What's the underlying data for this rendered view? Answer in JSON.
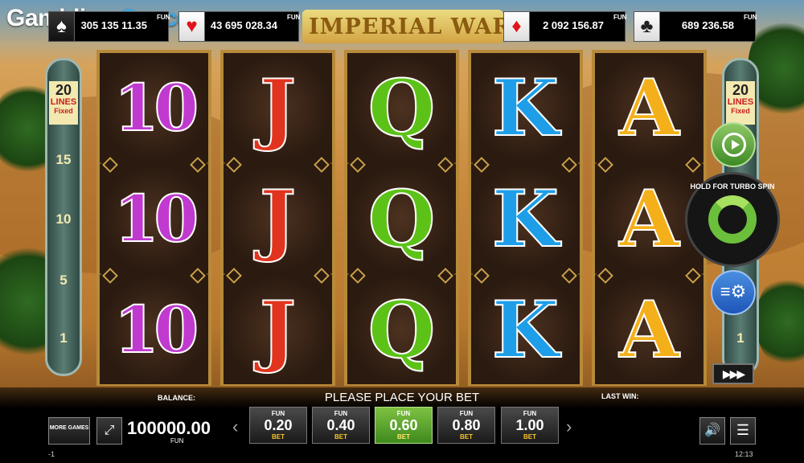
{
  "brand": {
    "part1": "Gambling",
    "part2": "Space"
  },
  "game_title": "IMPERIAL WARS",
  "jackpots": [
    {
      "suit": "♠",
      "value": "305 135 11.35",
      "currency": "FUN"
    },
    {
      "suit": "♥",
      "value": "43 695 028.34",
      "currency": "FUN"
    },
    {
      "suit": "♦",
      "value": "2 092 156.87",
      "currency": "FUN"
    },
    {
      "suit": "♣",
      "value": "689 236.58",
      "currency": "FUN"
    }
  ],
  "lines_panel": {
    "count": "20",
    "label": "LINES",
    "note": "Fixed",
    "markers": [
      "15",
      "10",
      "5",
      "1"
    ]
  },
  "right_lines_panel": {
    "count": "20",
    "label": "LINES",
    "note": "Fixed",
    "marker": "1"
  },
  "reels": [
    {
      "symbols": [
        "10",
        "10",
        "10"
      ],
      "color": "#c03ad0"
    },
    {
      "symbols": [
        "J",
        "J",
        "J"
      ],
      "color": "#e0341e"
    },
    {
      "symbols": [
        "Q",
        "Q",
        "Q"
      ],
      "color": "#5cc218"
    },
    {
      "symbols": [
        "K",
        "K",
        "K"
      ],
      "color": "#1e9ee8"
    },
    {
      "symbols": [
        "A",
        "A",
        "A"
      ],
      "color": "#f4b01a"
    }
  ],
  "spin_button": {
    "hint": "HOLD FOR TURBO SPIN"
  },
  "bottom": {
    "balance_label": "BALANCE:",
    "balance_value": "100000.00",
    "balance_currency": "FUN",
    "message": "PLEASE PLACE YOUR BET",
    "last_win_label": "LAST WIN:",
    "more_games": "MORE GAMES",
    "bets": [
      {
        "currency": "FUN",
        "value": "0.20",
        "label": "BET"
      },
      {
        "currency": "FUN",
        "value": "0.40",
        "label": "BET"
      },
      {
        "currency": "FUN",
        "value": "0.60",
        "label": "BET",
        "selected": true
      },
      {
        "currency": "FUN",
        "value": "0.80",
        "label": "BET"
      },
      {
        "currency": "FUN",
        "value": "1.00",
        "label": "BET"
      }
    ],
    "prev_arrow": "‹",
    "next_arrow": "›"
  },
  "status_bar": {
    "left": "-1",
    "time": "12:13"
  },
  "icons": {
    "fullscreen": "fullscreen-icon",
    "sound": "speaker-icon",
    "menu": "hamburger-menu-icon",
    "autoplay": "autoplay-icon",
    "settings": "settings-icon",
    "turbo": "fast-forward-icon"
  }
}
